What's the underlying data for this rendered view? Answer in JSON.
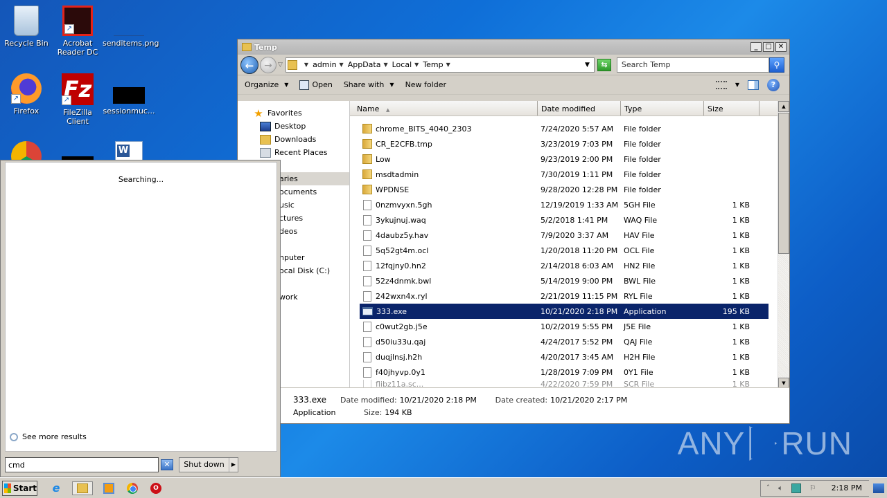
{
  "desktop": {
    "icons": [
      {
        "label": "Recycle Bin",
        "icon": "recycle-bin-icon"
      },
      {
        "label": "Acrobat Reader DC",
        "icon": "acrobat-icon"
      },
      {
        "label": "senditems.png",
        "icon": "image-file-icon"
      },
      {
        "label": "Firefox",
        "icon": "firefox-icon"
      },
      {
        "label": "FileZilla Client",
        "icon": "filezilla-icon"
      },
      {
        "label": "sessionmuc...",
        "icon": "black-file-icon"
      },
      {
        "label": "",
        "icon": "chrome-icon"
      },
      {
        "label": "",
        "icon": "black-file-icon"
      },
      {
        "label": "",
        "icon": "word-doc-icon"
      }
    ]
  },
  "explorer": {
    "title": "Temp",
    "breadcrumb": [
      "admin",
      "AppData",
      "Local",
      "Temp"
    ],
    "search_placeholder": "Search Temp",
    "toolbar": {
      "organize": "Organize",
      "open": "Open",
      "share_with": "Share with",
      "new_folder": "New folder"
    },
    "nav": {
      "favorites": "Favorites",
      "desktop": "Desktop",
      "downloads": "Downloads",
      "recent_places": "Recent Places",
      "libraries": "aries",
      "documents": "ocuments",
      "music": "usic",
      "pictures": "ctures",
      "videos": "deos",
      "computer": "nputer",
      "local_disk": "ocal Disk (C:)",
      "network": "work"
    },
    "columns": {
      "name": "Name",
      "date": "Date modified",
      "type": "Type",
      "size": "Size"
    },
    "files": [
      {
        "name": "chrome_BITS_4040_2303",
        "date": "7/24/2020 5:57 AM",
        "type": "File folder",
        "size": "",
        "kind": "folder"
      },
      {
        "name": "CR_E2CFB.tmp",
        "date": "3/23/2019 7:03 PM",
        "type": "File folder",
        "size": "",
        "kind": "folder"
      },
      {
        "name": "Low",
        "date": "9/23/2019 2:00 PM",
        "type": "File folder",
        "size": "",
        "kind": "folder"
      },
      {
        "name": "msdtadmin",
        "date": "7/30/2019 1:11 PM",
        "type": "File folder",
        "size": "",
        "kind": "folder"
      },
      {
        "name": "WPDNSE",
        "date": "9/28/2020 12:28 PM",
        "type": "File folder",
        "size": "",
        "kind": "folder"
      },
      {
        "name": "0nzmvyxn.5gh",
        "date": "12/19/2019 1:33 AM",
        "type": "5GH File",
        "size": "1 KB",
        "kind": "file"
      },
      {
        "name": "3ykujnuj.waq",
        "date": "5/2/2018 1:41 PM",
        "type": "WAQ File",
        "size": "1 KB",
        "kind": "file"
      },
      {
        "name": "4daubz5y.hav",
        "date": "7/9/2020 3:37 AM",
        "type": "HAV File",
        "size": "1 KB",
        "kind": "file"
      },
      {
        "name": "5q52gt4m.ocl",
        "date": "1/20/2018 11:20 PM",
        "type": "OCL File",
        "size": "1 KB",
        "kind": "file"
      },
      {
        "name": "12fqjny0.hn2",
        "date": "2/14/2018 6:03 AM",
        "type": "HN2 File",
        "size": "1 KB",
        "kind": "file"
      },
      {
        "name": "52z4dnmk.bwl",
        "date": "5/14/2019 9:00 PM",
        "type": "BWL File",
        "size": "1 KB",
        "kind": "file"
      },
      {
        "name": "242wxn4x.ryl",
        "date": "2/21/2019 11:15 PM",
        "type": "RYL File",
        "size": "1 KB",
        "kind": "file"
      },
      {
        "name": "333.exe",
        "date": "10/21/2020 2:18 PM",
        "type": "Application",
        "size": "195 KB",
        "kind": "app",
        "selected": true
      },
      {
        "name": "c0wut2gb.j5e",
        "date": "10/2/2019 5:55 PM",
        "type": "J5E File",
        "size": "1 KB",
        "kind": "file"
      },
      {
        "name": "d50iu33u.qaj",
        "date": "4/24/2017 5:52 PM",
        "type": "QAJ File",
        "size": "1 KB",
        "kind": "file"
      },
      {
        "name": "duqjlnsj.h2h",
        "date": "4/20/2017 3:45 AM",
        "type": "H2H File",
        "size": "1 KB",
        "kind": "file"
      },
      {
        "name": "f40jhyvp.0y1",
        "date": "1/28/2019 7:09 PM",
        "type": "0Y1 File",
        "size": "1 KB",
        "kind": "file"
      },
      {
        "name": "flibz11a.sc...",
        "date": "4/22/2020 7:59 PM",
        "type": "SCR File",
        "size": "1 KB",
        "kind": "file",
        "partial": true
      }
    ],
    "details": {
      "name": "333.exe",
      "type": "Application",
      "date_modified_label": "Date modified:",
      "date_modified": "10/21/2020 2:18 PM",
      "date_created_label": "Date created:",
      "date_created": "10/21/2020 2:17 PM",
      "size_label": "Size:",
      "size": "194 KB"
    }
  },
  "start_menu": {
    "status": "Searching...",
    "see_more": "See more results",
    "search_value": "cmd",
    "shutdown_label": "Shut down"
  },
  "taskbar": {
    "start_label": "Start",
    "clock": "2:18 PM"
  },
  "watermark": {
    "left": "ANY",
    "right": "RUN"
  }
}
